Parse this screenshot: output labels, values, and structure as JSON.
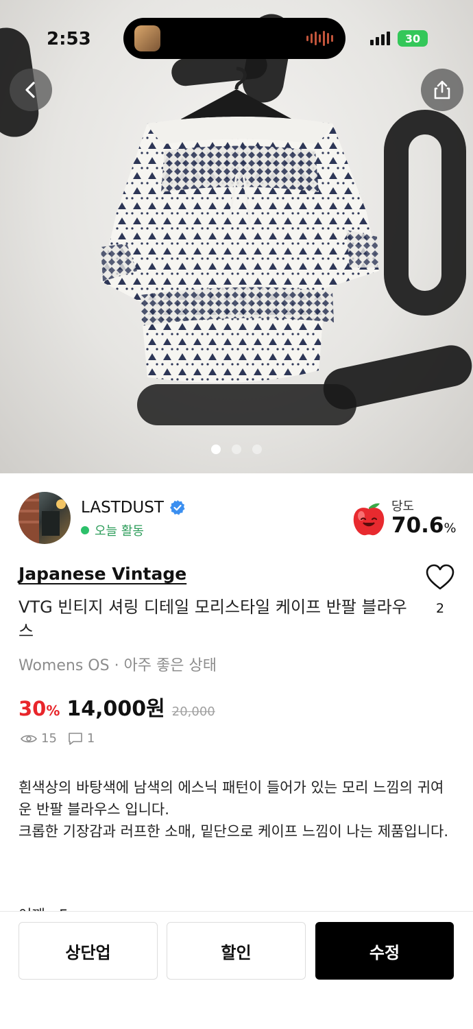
{
  "status_bar": {
    "time": "2:53",
    "battery": "30"
  },
  "hero": {
    "page_count": 3,
    "active_page": 1
  },
  "seller": {
    "name": "LASTDUST",
    "activity": "오늘 활동"
  },
  "sweetness": {
    "label": "당도",
    "value": "70.6",
    "unit": "%"
  },
  "product": {
    "brand": "Japanese Vintage",
    "title": "VTG 빈티지 셔링 디테일 모리스타일 케이프 반팔 블라우스",
    "meta": "Womens OS · 아주 좋은 상태",
    "likes": "2",
    "discount": "30",
    "discount_unit": "%",
    "price": "14,000원",
    "original_price": "20,000",
    "views": "15",
    "comments": "1",
    "description": [
      "흰색상의 바탕색에 남색의 에스닉 패턴이 들어가 있는 모리 느낌의 귀여운 반팔 블라우스 입니다.",
      "크롭한 기장감과 러프한 소매, 밑단으로 케이프 느낌이 나는 제품입니다."
    ],
    "description_cut": "어깨 : F"
  },
  "actions": {
    "bump": "상단업",
    "discount": "할인",
    "edit": "수정"
  },
  "colors": {
    "accent_red": "#e8262b",
    "active_green": "#2cc06a",
    "verified_blue": "#3b8ff0"
  }
}
